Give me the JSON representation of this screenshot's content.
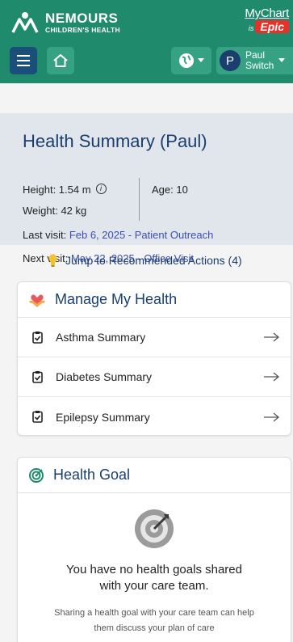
{
  "header": {
    "brand_name": "NEMOURS",
    "brand_sub": "CHILDREN'S HEALTH",
    "mychart_label": "MyChart",
    "mychart_is": "is",
    "epic_label": "Epic",
    "switch_name": "Paul",
    "switch_action": "Switch",
    "avatar_initial": "P",
    "accent_color": "#1f8a6c"
  },
  "summary": {
    "title": "Health Summary (Paul)",
    "height_label": "Height: 1.54 m",
    "age_label": "Age: 10",
    "weight_label": "Weight: 42 kg",
    "last_visit_label": "Last visit:",
    "last_visit_link": "Feb 6, 2025 - Patient Outreach",
    "next_visit_label": "Next visit:",
    "next_visit_link": "May 22, 2025 - Office Visit"
  },
  "jump_link": "Jump to Recommended Actions (4)",
  "manage_card": {
    "title": "Manage My Health",
    "items": [
      {
        "label": "Asthma Summary"
      },
      {
        "label": "Diabetes Summary"
      },
      {
        "label": "Epilepsy Summary"
      }
    ]
  },
  "goal_card": {
    "title": "Health Goal",
    "message": "You have no health goals shared with your care team.",
    "detail": "Sharing a health goal with your care team can help them discuss your plan of care"
  }
}
